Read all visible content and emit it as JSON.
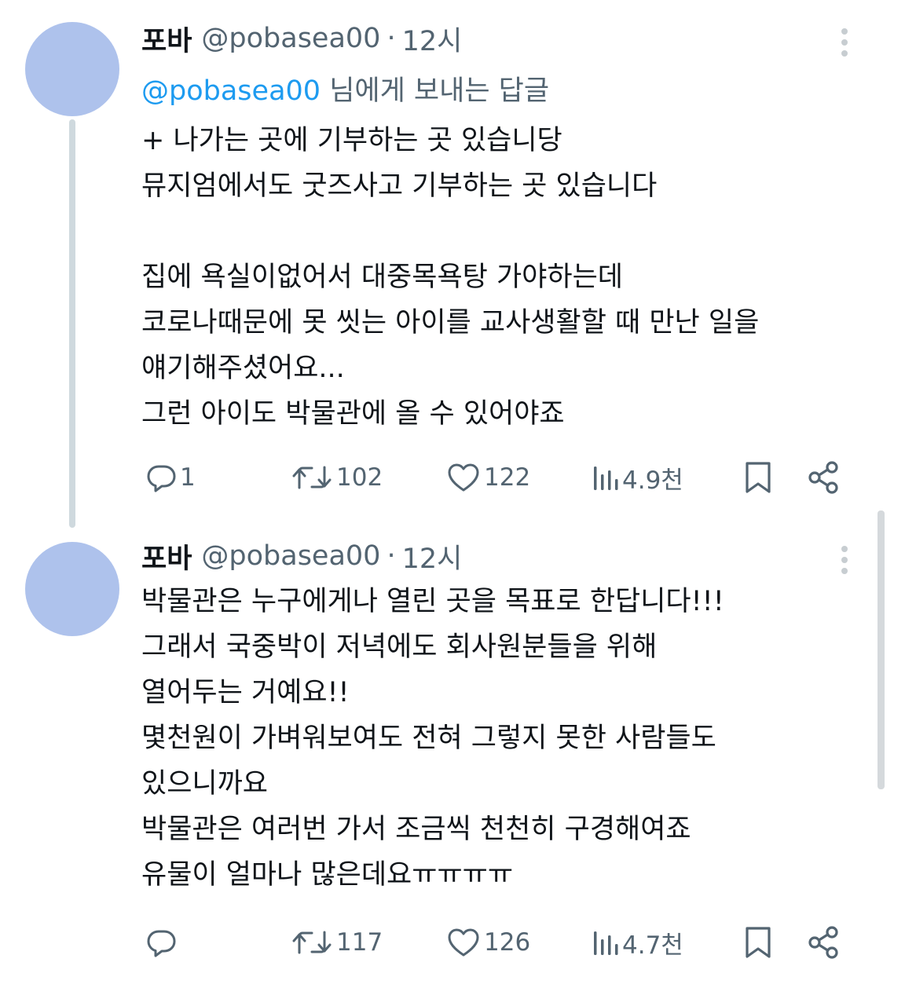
{
  "tweets": [
    {
      "author": {
        "name": "포바",
        "handle": "@pobasea00",
        "time": "12시"
      },
      "separator": "·",
      "reply_to": {
        "mention": "@pobasea00",
        "suffix": "님에게 보내는 답글"
      },
      "text_lines": [
        "+ 나가는 곳에 기부하는 곳 있습니당",
        "뮤지엄에서도 굿즈사고 기부하는 곳 있습니다",
        "",
        "집에 욕실이없어서 대중목욕탕 가야하는데",
        "코로나때문에 못 씻는 아이를 교사생활할 때 만난 일을",
        "얘기해주셨어요...",
        "그런 아이도 박물관에 올 수 있어야죠"
      ],
      "stats": {
        "replies": "1",
        "reposts": "102",
        "likes": "122",
        "views": "4.9천"
      }
    },
    {
      "author": {
        "name": "포바",
        "handle": "@pobasea00",
        "time": "12시"
      },
      "separator": "·",
      "text_lines": [
        "박물관은 누구에게나 열린 곳을 목표로 한답니다!!!",
        "그래서 국중박이 저녁에도 회사원분들을 위해",
        "열어두는 거예요!!",
        "몇천원이 가벼워보여도 전혀 그렇지 못한 사람들도",
        "있으니까요",
        "박물관은 여러번 가서 조금씩 천천히 구경해여죠",
        "유물이 얼마나 많은데요ㅠㅠㅠㅠ"
      ],
      "stats": {
        "replies": "",
        "reposts": "117",
        "likes": "126",
        "views": "4.7천"
      }
    }
  ],
  "icons": {
    "reply": "reply-icon",
    "repost": "repost-icon",
    "like": "heart-icon",
    "views": "views-icon",
    "bookmark": "bookmark-icon",
    "share": "share-icon",
    "more": "more-vertical-icon"
  },
  "colors": {
    "text": "#0f1419",
    "secondary": "#536471",
    "link": "#1d9bf0",
    "avatar": "#aec2ec",
    "thread_line": "#cfd9de"
  }
}
